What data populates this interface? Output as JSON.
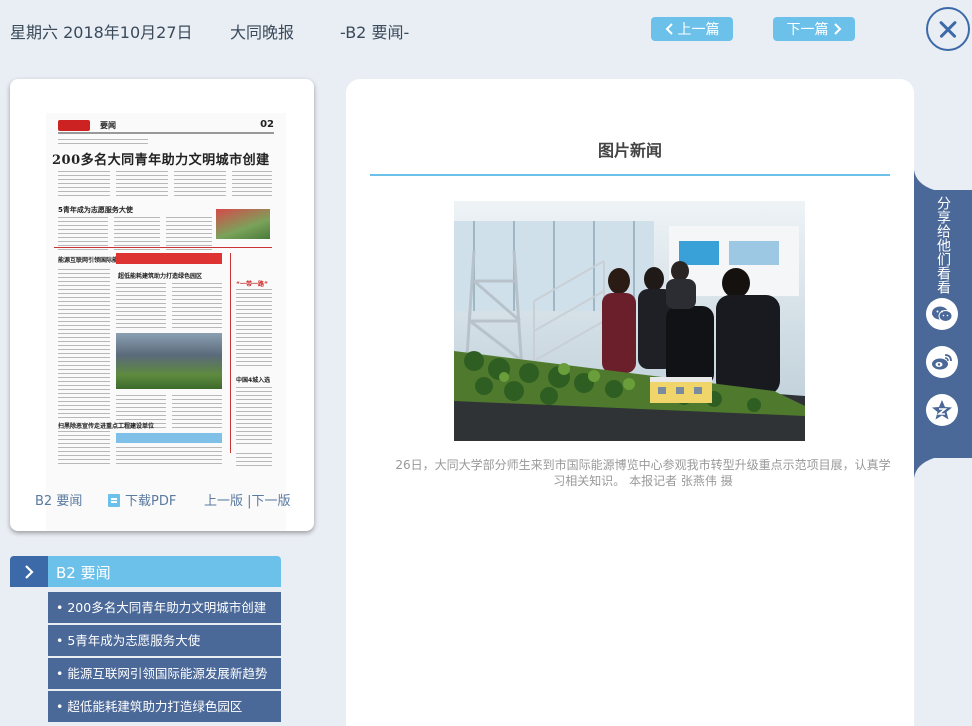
{
  "header": {
    "date": "星期六 2018年10月27日",
    "paper_name": "大同晚报",
    "page_label": "-B2 要闻-",
    "prev_article": "上一篇",
    "next_article": "下一篇"
  },
  "paper_preview": {
    "thumb_section": "要闻",
    "thumb_page_number": "02",
    "thumb_headline": "200多名大同青年助力文明城市创建",
    "thumb_subheads": [
      "5青年成为志愿服务大使",
      "能源互联网引领国际能源发展新趋势",
      "超低能耗建筑助力打造绿色园区",
      "“一带一路”",
      "中国4城入选",
      "扫黑除恶宣传走进重点工程建设单位"
    ],
    "page_link": "B2 要闻",
    "pdf_download": "下载PDF",
    "prev_page": "上一版",
    "separator": " |",
    "next_page": "下一版"
  },
  "section": {
    "title": "B2  要闻",
    "articles": [
      "• 200多名大同青年助力文明城市创建",
      "• 5青年成为志愿服务大使",
      "• 能源互联网引领国际能源发展新趋势",
      "• 超低能耗建筑助力打造绿色园区"
    ]
  },
  "article": {
    "title": "图片新闻",
    "caption": "26日，大同大学部分师生来到市国际能源博览中心参观我市转型升级重点示范项目展，认真学习相关知识。 本报记者 张燕伟 摄"
  },
  "share": {
    "label": "分享给他们看看",
    "icons": [
      "wechat-icon",
      "weibo-icon",
      "qzone-icon"
    ]
  },
  "colors": {
    "accent": "#6cc1ea",
    "dark_blue": "#3c6aa8",
    "list_bg": "#4a6898",
    "page_bg": "#e9eef4"
  }
}
